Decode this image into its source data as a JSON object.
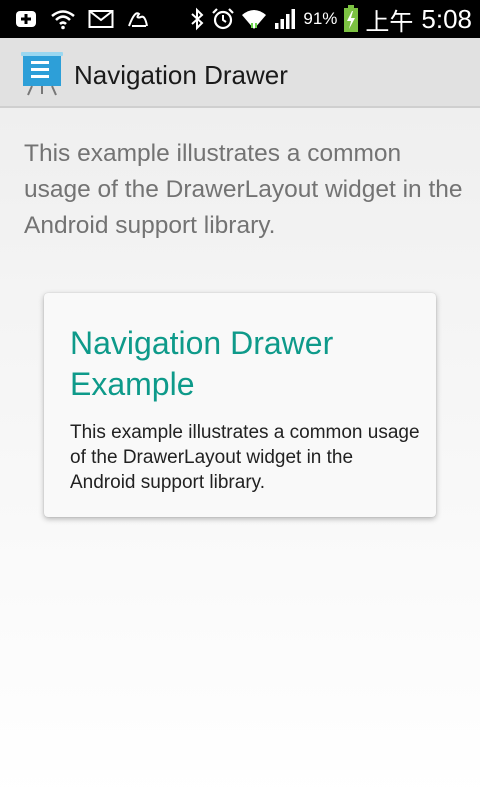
{
  "status_bar": {
    "battery_percent": "91%",
    "ampm": "上午",
    "time": "5:08",
    "icons": [
      "add-notification-icon",
      "wifi-notification-icon",
      "email-icon",
      "app-notification-icon",
      "bluetooth-icon",
      "alarm-icon",
      "wifi-icon",
      "signal-icon",
      "battery-charging-icon"
    ]
  },
  "action_bar": {
    "title": "Navigation Drawer",
    "icon": "presentation-board-icon"
  },
  "content": {
    "intro": "This example illustrates a common usage of the DrawerLayout widget in the Android support library.",
    "card": {
      "title": "Navigation Drawer Example",
      "body": "This example illustrates a common usage of the DrawerLayout widget in the Android support library."
    }
  },
  "colors": {
    "status_bar_bg": "#000000",
    "action_bar_bg": "#e1e1e1",
    "accent_teal": "#0e9a8a",
    "battery_green": "#7cc242",
    "icon_blue": "#33a7dd"
  }
}
